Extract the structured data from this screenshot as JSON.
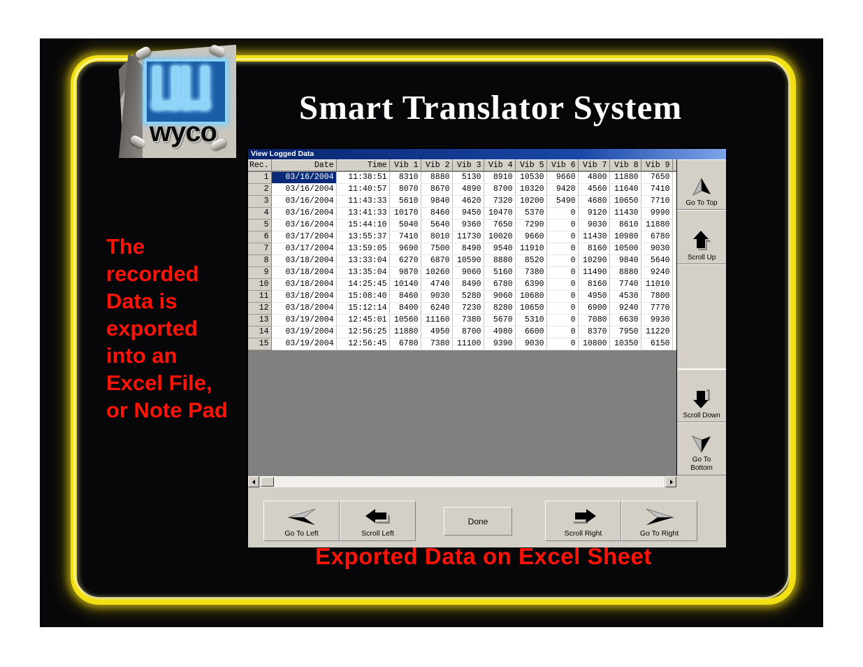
{
  "slide": {
    "title": "Smart Translator System",
    "caption": "Exported Data on Excel Sheet",
    "side_note": "The recorded Data is exported into an Excel File, or Note Pad",
    "logo_word": "wyco",
    "colors": {
      "neon": "#f2e014",
      "red_text": "#fc1408",
      "panel": "#070709",
      "titlebar": "#07246b"
    }
  },
  "window": {
    "title": "View Logged Data",
    "columns": [
      "Rec.",
      "Date",
      "Time",
      "Vib 1",
      "Vib 2",
      "Vib 3",
      "Vib 4",
      "Vib 5",
      "Vib 6",
      "Vib 7",
      "Vib 8",
      "Vib 9"
    ],
    "rows": [
      [
        "1",
        "03/16/2004",
        "11:38:51",
        "8310",
        "8880",
        "5130",
        "8910",
        "10530",
        "9660",
        "4800",
        "11880",
        "7650"
      ],
      [
        "2",
        "03/16/2004",
        "11:40:57",
        "8070",
        "8670",
        "4890",
        "8700",
        "10320",
        "9420",
        "4560",
        "11640",
        "7410"
      ],
      [
        "3",
        "03/16/2004",
        "11:43:33",
        "5610",
        "9840",
        "4620",
        "7320",
        "10200",
        "5490",
        "4680",
        "10650",
        "7710"
      ],
      [
        "4",
        "03/16/2004",
        "13:41:33",
        "10170",
        "8460",
        "9450",
        "10470",
        "5370",
        "0",
        "9120",
        "11430",
        "9990"
      ],
      [
        "5",
        "03/16/2004",
        "15:44:10",
        "5040",
        "5640",
        "9360",
        "7650",
        "7290",
        "0",
        "9030",
        "8610",
        "11880"
      ],
      [
        "6",
        "03/17/2004",
        "13:55:37",
        "7410",
        "8010",
        "11730",
        "10020",
        "9660",
        "0",
        "11430",
        "10980",
        "6780"
      ],
      [
        "7",
        "03/17/2004",
        "13:59:05",
        "9690",
        "7500",
        "8490",
        "9540",
        "11910",
        "0",
        "8160",
        "10500",
        "9030"
      ],
      [
        "8",
        "03/18/2004",
        "13:33:04",
        "6270",
        "6870",
        "10590",
        "8880",
        "8520",
        "0",
        "10290",
        "9840",
        "5640"
      ],
      [
        "9",
        "03/18/2004",
        "13:35:04",
        "9870",
        "10260",
        "9060",
        "5160",
        "7380",
        "0",
        "11490",
        "8880",
        "9240"
      ],
      [
        "10",
        "03/18/2004",
        "14:25:45",
        "10140",
        "4740",
        "8490",
        "6780",
        "6390",
        "0",
        "8160",
        "7740",
        "11010"
      ],
      [
        "11",
        "03/18/2004",
        "15:08:40",
        "8460",
        "9030",
        "5280",
        "9060",
        "10680",
        "0",
        "4950",
        "4530",
        "7800"
      ],
      [
        "12",
        "03/18/2004",
        "15:12:14",
        "8400",
        "6240",
        "7230",
        "8280",
        "10650",
        "0",
        "6900",
        "9240",
        "7770"
      ],
      [
        "13",
        "03/19/2004",
        "12:45:01",
        "10560",
        "11160",
        "7380",
        "5670",
        "5310",
        "0",
        "7080",
        "6630",
        "9930"
      ],
      [
        "14",
        "03/19/2004",
        "12:56:25",
        "11880",
        "4950",
        "8700",
        "4980",
        "6600",
        "0",
        "8370",
        "7950",
        "11220"
      ],
      [
        "15",
        "03/19/2004",
        "12:56:45",
        "6780",
        "7380",
        "11100",
        "9390",
        "9030",
        "0",
        "10800",
        "10350",
        "6150"
      ]
    ],
    "selected_cell": {
      "row": 1,
      "column": "Date",
      "value": "03/16/2004"
    },
    "vertical_buttons": [
      {
        "label": "Go To Top",
        "icon": "triangle-up-icon"
      },
      {
        "label": "Scroll Up",
        "icon": "arrow-up-icon"
      },
      {
        "label": "Scroll Down",
        "icon": "arrow-down-icon"
      },
      {
        "label": "Go To\nBottom",
        "icon": "triangle-down-icon"
      }
    ],
    "vertical_button_labels": {
      "go_to_top": "Go To Top",
      "scroll_up": "Scroll Up",
      "scroll_down": "Scroll Down",
      "go_to_bottom_line1": "Go To",
      "go_to_bottom_line2": "Bottom"
    },
    "bottom_buttons": {
      "go_to_left": "Go To Left",
      "scroll_left": "Scroll Left",
      "done": "Done",
      "scroll_right": "Scroll Right",
      "go_to_right": "Go To Right"
    }
  }
}
